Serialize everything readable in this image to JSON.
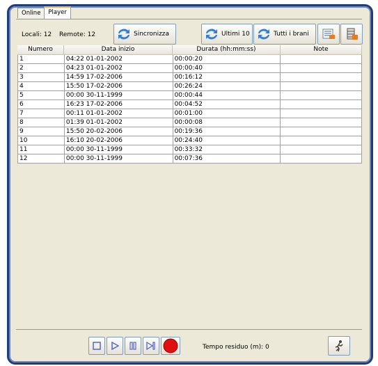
{
  "tabs": [
    "Online",
    "Player"
  ],
  "toolbar": {
    "locali": "Locali: 12",
    "remote": "Remote: 12",
    "sincronizza": "Sincronizza",
    "ultimi": "Ultimi 10",
    "tutti": "Tutti i brani"
  },
  "table": {
    "headers": [
      "Numero",
      "Data inizio",
      "Durata (hh:mm:ss)",
      "Note"
    ],
    "rows": [
      [
        "1",
        "04:22 01-01-2002",
        "00:00:20",
        ""
      ],
      [
        "2",
        "04:23 01-01-2002",
        "00:00:40",
        ""
      ],
      [
        "3",
        "14:59 17-02-2006",
        "00:16:12",
        ""
      ],
      [
        "4",
        "15:50 17-02-2006",
        "00:26:24",
        ""
      ],
      [
        "5",
        "00:00 30-11-1999",
        "00:00:44",
        ""
      ],
      [
        "6",
        "16:23 17-02-2006",
        "00:04:52",
        ""
      ],
      [
        "7",
        "00:11 01-01-2002",
        "00:01:00",
        ""
      ],
      [
        "8",
        "01:39 01-01-2002",
        "00:00:08",
        ""
      ],
      [
        "9",
        "15:50 20-02-2006",
        "00:19:36",
        ""
      ],
      [
        "10",
        "16:10 20-02-2006",
        "00:24:40",
        ""
      ],
      [
        "11",
        "00:00 30-11-1999",
        "00:33:32",
        ""
      ],
      [
        "12",
        "00:00 30-11-1999",
        "00:07:36",
        ""
      ]
    ]
  },
  "footer": {
    "tempo": "Tempo residuo (m): 0"
  },
  "colors": {
    "frame": "#1f3c7a",
    "record": "#e01010",
    "controls": "#5566cc"
  }
}
